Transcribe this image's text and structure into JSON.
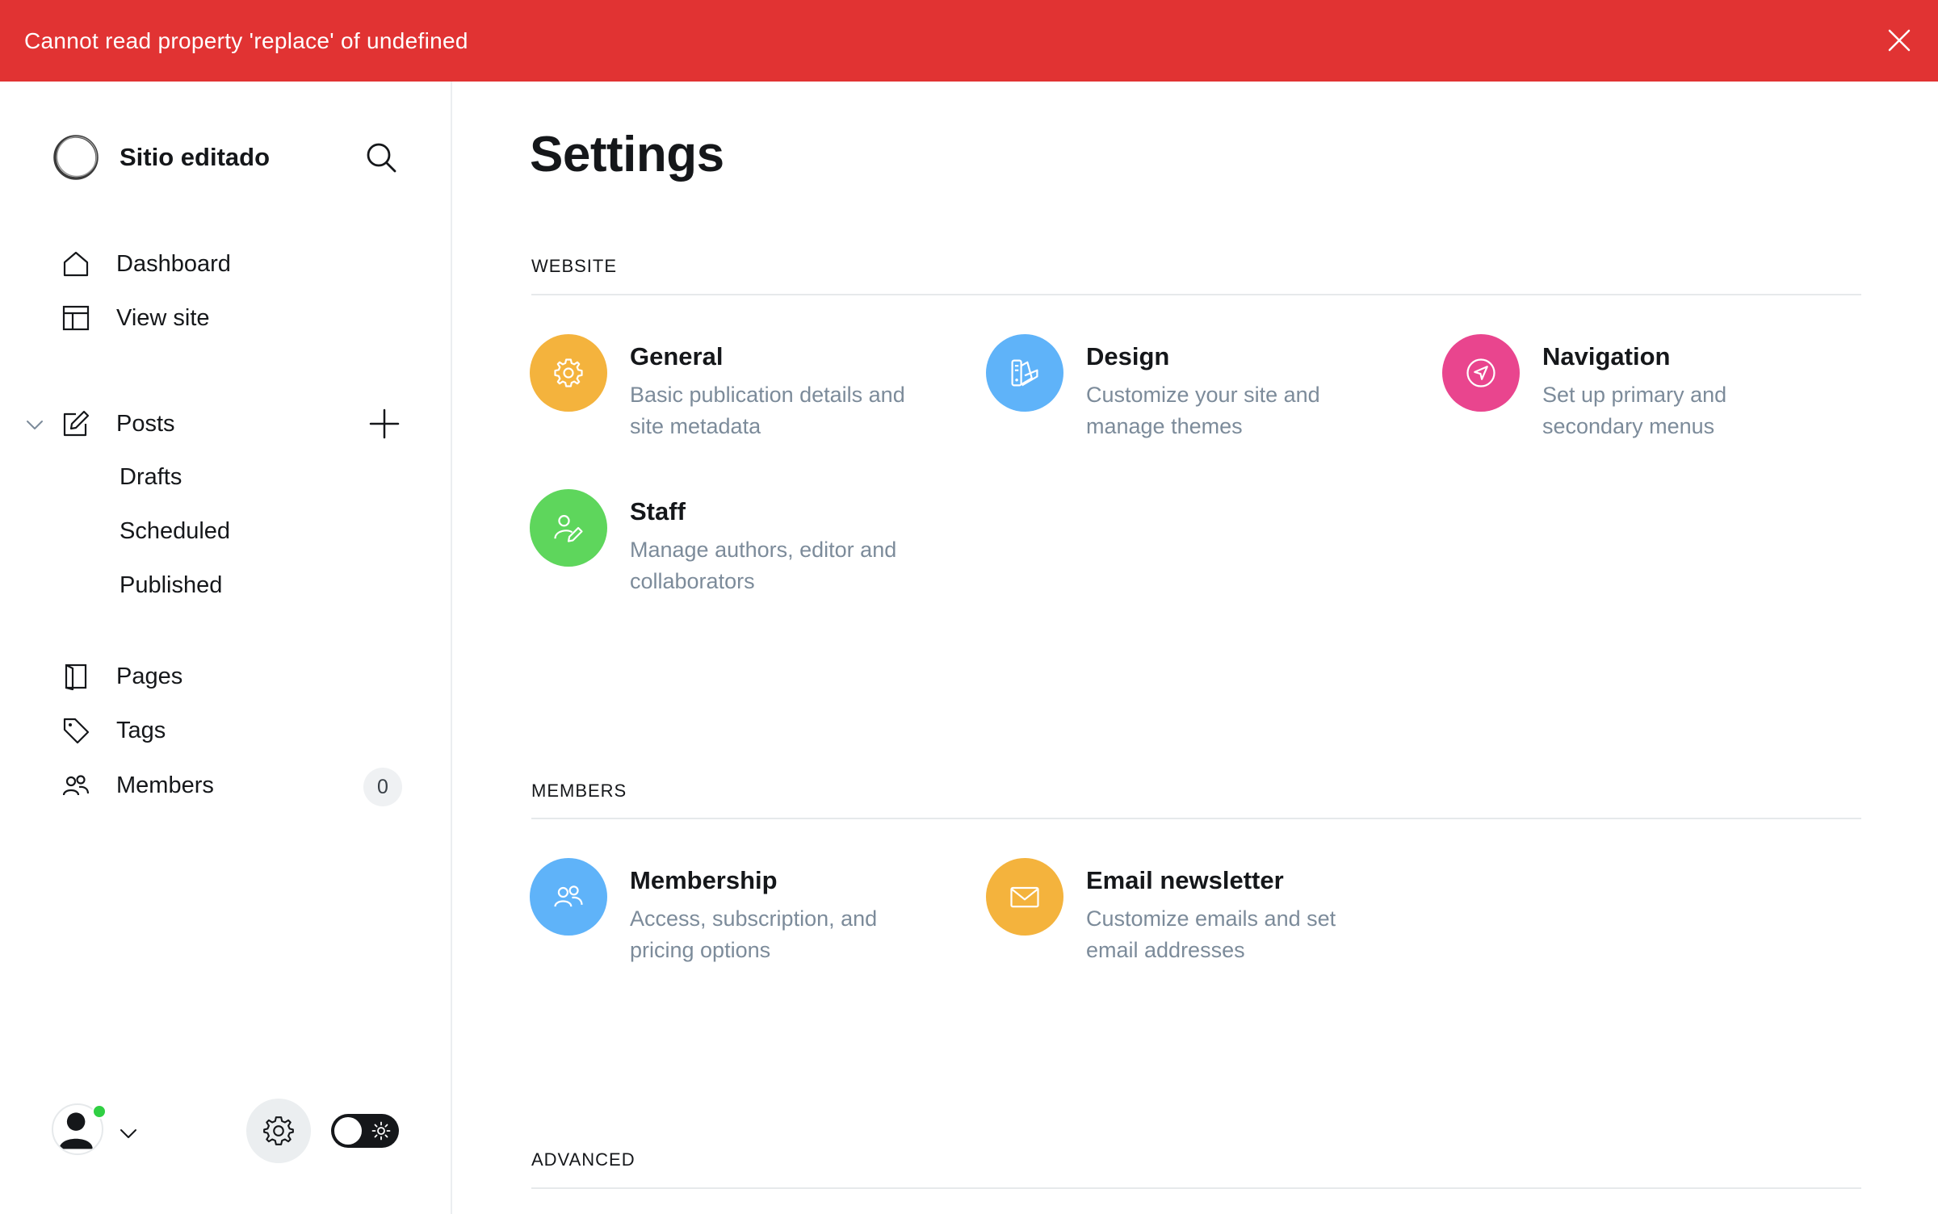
{
  "alert": {
    "message": "Cannot read property 'replace' of undefined",
    "color": "#e13333"
  },
  "sidebar": {
    "site_name": "Sitio editado",
    "nav": {
      "dashboard": "Dashboard",
      "view_site": "View site",
      "posts": "Posts",
      "drafts": "Drafts",
      "scheduled": "Scheduled",
      "published": "Published",
      "pages": "Pages",
      "tags": "Tags",
      "members": "Members",
      "members_count": "0"
    }
  },
  "main": {
    "title": "Settings",
    "sections": {
      "website": {
        "title": "WEBSITE",
        "cards": [
          {
            "title": "General",
            "desc_1": "Basic publication details and",
            "desc_2": "site metadata",
            "icon": "gear-icon",
            "color": "#f4b33d"
          },
          {
            "title": "Design",
            "desc_1": "Customize your site and",
            "desc_2": "manage themes",
            "icon": "palette-icon",
            "color": "#5fb3f9"
          },
          {
            "title": "Navigation",
            "desc_1": "Set up primary and",
            "desc_2": "secondary menus",
            "icon": "compass-icon",
            "color": "#e9458e"
          },
          {
            "title": "Staff",
            "desc_1": "Manage authors, editor and",
            "desc_2": "collaborators",
            "icon": "user-edit-icon",
            "color": "#5ed65c"
          }
        ]
      },
      "members": {
        "title": "MEMBERS",
        "cards": [
          {
            "title": "Membership",
            "desc_1": "Access, subscription, and",
            "desc_2": "pricing options",
            "icon": "users-icon",
            "color": "#5fb3f9"
          },
          {
            "title": "Email newsletter",
            "desc_1": "Customize emails and set",
            "desc_2": "email addresses",
            "icon": "envelope-icon",
            "color": "#f4b33d"
          }
        ]
      },
      "advanced": {
        "title": "ADVANCED"
      }
    }
  }
}
